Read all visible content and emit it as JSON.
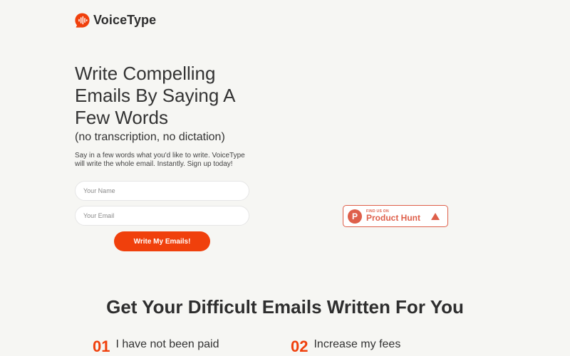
{
  "brand": {
    "name": "VoiceType",
    "accent": "#f0400c",
    "icon": "voice-bubble-icon"
  },
  "hero": {
    "title": "Write Compelling Emails By Saying A Few Words",
    "subtitle": "(no transcription, no dictation)",
    "description": "Say in a few words what you'd like to write. VoiceType will write the whole email. Instantly. Sign up today!"
  },
  "form": {
    "name_placeholder": "Your Name",
    "name_value": "",
    "email_placeholder": "Your Email",
    "email_value": "",
    "submit_label": "Write My Emails!"
  },
  "product_hunt": {
    "small_label": "FIND US ON",
    "big_label": "Product Hunt",
    "logo_letter": "P",
    "color": "#de5f4a"
  },
  "features": {
    "title": "Get Your Difficult Emails Written For You",
    "items": [
      {
        "number": "01",
        "text": "I have not been paid"
      },
      {
        "number": "02",
        "text": "Increase my fees"
      }
    ]
  }
}
